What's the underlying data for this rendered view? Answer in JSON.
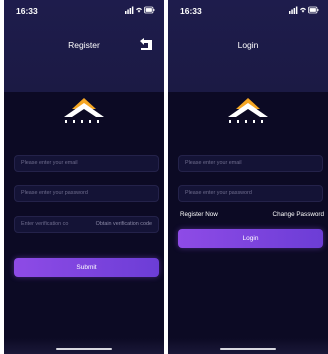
{
  "colors": {
    "background": "#0c0a24",
    "header": "#1e1c4c",
    "input_background": "#141336",
    "button_gradient_start": "#8e4be6",
    "button_gradient_end": "#6c3dd6",
    "logo_orange": "#f5a623"
  },
  "register_screen": {
    "status": {
      "time": "16:33"
    },
    "nav": {
      "title": "Register",
      "back_icon": "back-return-icon"
    },
    "logo": {
      "icon": "brand-mountain-logo-icon"
    },
    "form": {
      "email_placeholder": "Please enter your email",
      "password_placeholder": "Please enter your password",
      "verification_placeholder": "Enter verification co",
      "obtain_code_label": "Obtain verification code",
      "submit_label": "Submit"
    }
  },
  "login_screen": {
    "status": {
      "time": "16:33"
    },
    "nav": {
      "title": "Login"
    },
    "logo": {
      "icon": "brand-mountain-logo-icon"
    },
    "form": {
      "email_placeholder": "Please enter your email",
      "password_placeholder": "Please enter your password",
      "register_now_label": "Register Now",
      "change_password_label": "Change Password",
      "login_label": "Login"
    }
  }
}
